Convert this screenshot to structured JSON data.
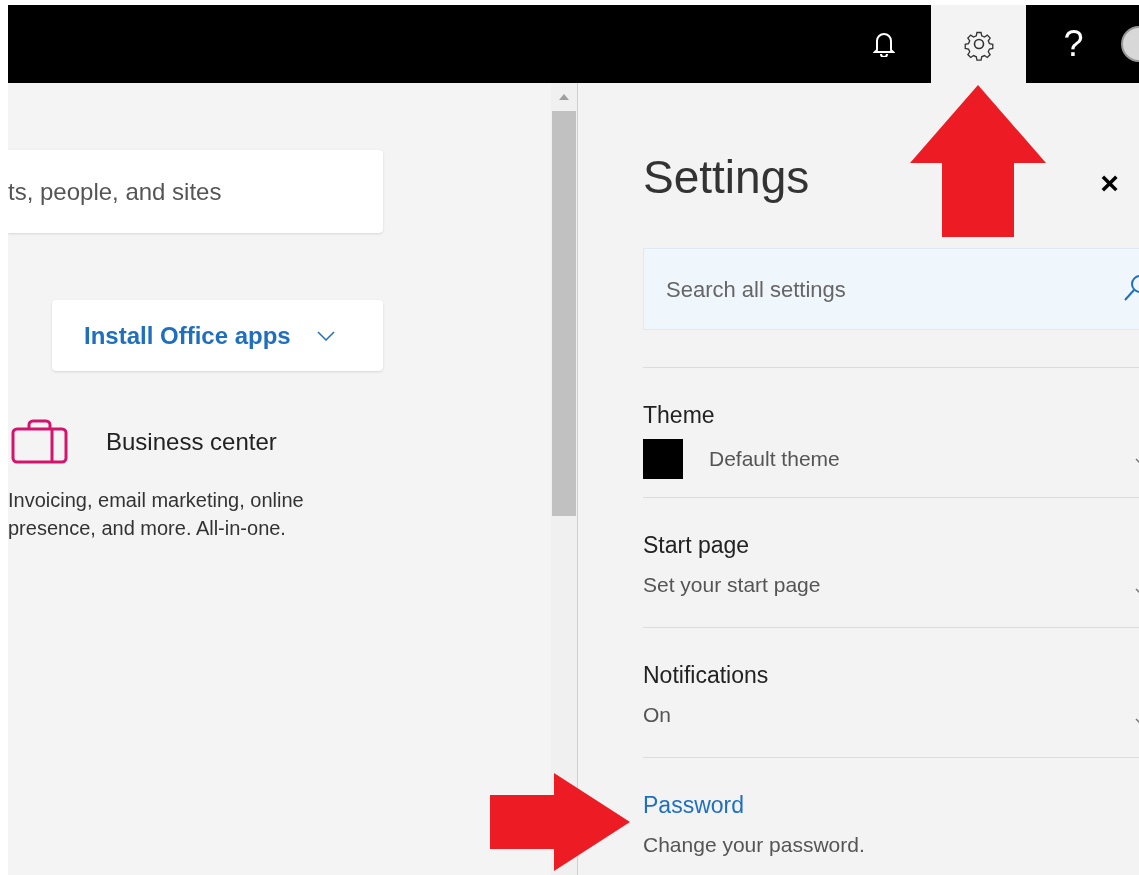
{
  "top_bar": {
    "buttons": [
      {
        "kind": "bell",
        "selected": false
      },
      {
        "kind": "gear",
        "selected": true
      },
      {
        "kind": "help",
        "selected": false,
        "label": "?"
      }
    ]
  },
  "main": {
    "search": {
      "placeholder": "ts, people, and sites"
    },
    "install_button": {
      "label": "Install Office apps"
    },
    "app": {
      "title": "Business center",
      "description": "Invoicing, email marketing, online presence, and more. All-in-one."
    }
  },
  "settings": {
    "title": "Settings",
    "close": "×",
    "search": {
      "placeholder": "Search all settings"
    },
    "items": [
      {
        "kind": "dropdown",
        "title": "Theme",
        "value": "Default theme",
        "swatch": true
      },
      {
        "kind": "dropdown",
        "title": "Start page",
        "value": "Set your start page"
      },
      {
        "kind": "dropdown",
        "title": "Notifications",
        "value": "On"
      },
      {
        "kind": "link",
        "title": "Password",
        "value": "Change your password."
      }
    ]
  }
}
